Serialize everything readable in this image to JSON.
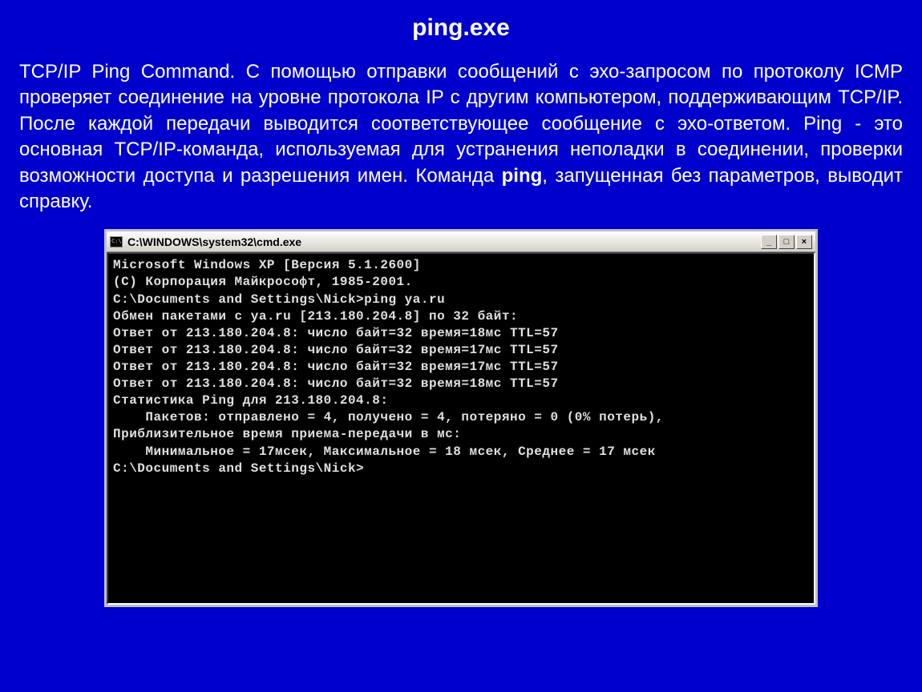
{
  "title": "ping.exe",
  "description": {
    "part1": "TCP/IP Ping Command. С помощью отправки сообщений с эхо-запросом по протоколу ICMP проверяет соединение на уровне протокола IP с другим компьютером, поддерживающим TCP/IP. После каждой передачи выводится соответствующее сообщение с эхо-ответом. Ping - это основная TCP/IP-команда, используемая для устранения неполадки в соединении, проверки возможности доступа и разрешения имен. Команда ",
    "bold": "ping",
    "part2": ", запущенная без параметров, выводит справку."
  },
  "window": {
    "title": "C:\\WINDOWS\\system32\\cmd.exe",
    "controls": {
      "minimize": "_",
      "maximize": "□",
      "close": "×"
    }
  },
  "terminal": {
    "lines": [
      "Microsoft Windows XP [Версия 5.1.2600]",
      "(C) Корпорация Майкрософт, 1985-2001.",
      "",
      "C:\\Documents and Settings\\Nick>ping ya.ru",
      "",
      "Обмен пакетами с ya.ru [213.180.204.8] по 32 байт:",
      "",
      "Ответ от 213.180.204.8: число байт=32 время=18мс TTL=57",
      "Ответ от 213.180.204.8: число байт=32 время=17мс TTL=57",
      "Ответ от 213.180.204.8: число байт=32 время=17мс TTL=57",
      "Ответ от 213.180.204.8: число байт=32 время=18мс TTL=57",
      "",
      "Статистика Ping для 213.180.204.8:",
      "    Пакетов: отправлено = 4, получено = 4, потеряно = 0 (0% потерь),",
      "Приблизительное время приема-передачи в мс:",
      "    Минимальное = 17мсек, Максимальное = 18 мсек, Среднее = 17 мсек",
      "",
      "C:\\Documents and Settings\\Nick>"
    ]
  }
}
